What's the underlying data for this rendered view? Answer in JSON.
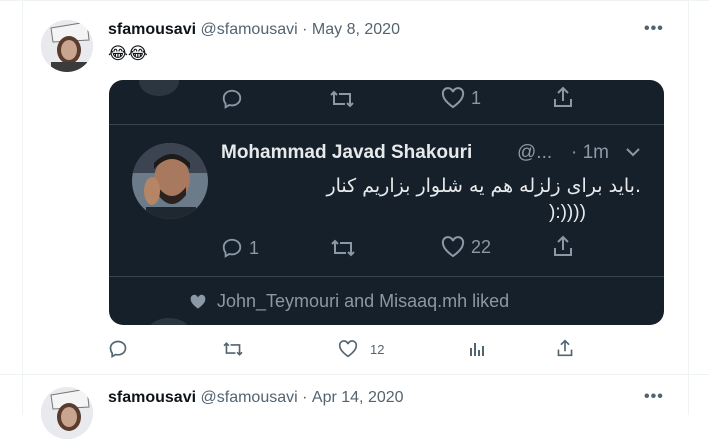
{
  "tweets": [
    {
      "display_name": "sfamousavi",
      "handle": "@sfamousavi",
      "separator": "·",
      "date": "May 8, 2020",
      "text": "😂😂",
      "actions": {
        "like_count": "12"
      }
    },
    {
      "display_name": "sfamousavi",
      "handle": "@sfamousavi",
      "separator": "·",
      "date": "Apr 14, 2020"
    }
  ],
  "embedded_screenshot": {
    "top_row": {
      "like_count": "1"
    },
    "author_name": "Mohammad Javad Shakouri",
    "author_handle": "@...",
    "time": "· 1m",
    "text_line1": ".باید برای زلزله هم یه شلوار بزاریم کنار",
    "text_line2": "):))))",
    "reply_count": "1",
    "like_count": "22",
    "liked_by": "John_Teymouri and Misaaq.mh liked"
  },
  "icons": [
    "more-icon",
    "reply-icon",
    "retweet-icon",
    "like-icon",
    "views-icon",
    "share-icon",
    "chevron-down-icon",
    "heart-small-icon"
  ]
}
